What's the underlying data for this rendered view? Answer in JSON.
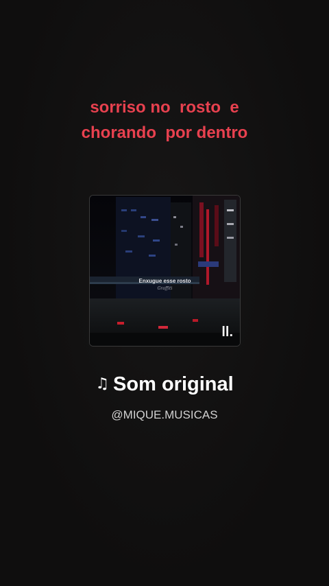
{
  "overlay_caption": "sorriso no  rosto  e\nchorando  por dentro",
  "cover": {
    "text": "Enxugue esse rosto",
    "subtext": "Graffiti",
    "watermark": "ll."
  },
  "sound": {
    "icon": "music-note-icon",
    "title": "Som original",
    "author": "@MIQUE.MUSICAS"
  },
  "colors": {
    "background": "#111010",
    "caption": "#e8414f",
    "title": "#ffffff",
    "author": "#d2d2d2"
  }
}
